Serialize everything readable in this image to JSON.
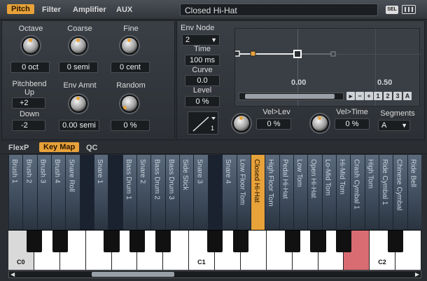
{
  "top_tabs": [
    {
      "label": "Pitch",
      "active": true
    },
    {
      "label": "Filter",
      "active": false
    },
    {
      "label": "Amplifier",
      "active": false
    },
    {
      "label": "AUX",
      "active": false
    }
  ],
  "preset_name": "Closed Hi-Hat",
  "sel_label": "SEL",
  "pitch": {
    "octave_label": "Octave",
    "octave_value": "0 oct",
    "coarse_label": "Coarse",
    "coarse_value": "0 semi",
    "fine_label": "Fine",
    "fine_value": "0 cent",
    "pitchbend_label": "Pitchbend Up",
    "pitchbend_up_value": "+2",
    "down_label": "Down",
    "down_value": "-2",
    "envamnt_label": "Env Amnt",
    "envamnt_value": "0.00 semi",
    "random_label": "Random",
    "random_value": "0 %"
  },
  "envelope": {
    "env_node_label": "Env Node",
    "env_node_value": "2",
    "time_label": "Time",
    "time_value": "100 ms",
    "curve_label": "Curve",
    "curve_value": "0.0",
    "level_label": "Level",
    "level_value": "0 %",
    "graph_label_left": "0.00",
    "graph_label_right": "0.50",
    "zoom_buttons": [
      "1",
      "2",
      "3",
      "A"
    ],
    "vel_lev_label": "Vel>Lev",
    "vel_lev_value": "0 %",
    "vel_time_label": "Vel>Time",
    "vel_time_value": "0 %",
    "segments_label": "Segments",
    "segments_value": "A",
    "curve_shape_number": "1"
  },
  "lower_tabs": [
    {
      "label": "FlexP",
      "active": false
    },
    {
      "label": "Key Map",
      "active": true
    },
    {
      "label": "QC",
      "active": false
    }
  ],
  "keymap": [
    "Brush 1",
    "Brush 2",
    "Brush 3",
    "Brush 4",
    "Snare Roll",
    "",
    "Snare 1",
    "",
    "Bass Drum 1",
    "Snare 2",
    "Bass Drum 2",
    "Bass Drum 3",
    "Side Stick",
    "Snare 3",
    "",
    "Snare 4",
    "Low Floor Tom",
    "Closed Hi-Hat",
    "High Floor Tom",
    "Pedal Hi-Hat",
    "Low Tom",
    "Open Hi-Hat",
    "Lo-Mid Tom",
    "Hi-Mid Tom",
    "Crash Cymbal 1",
    "High Tom",
    "Ride Cymbal 1",
    "Chinese Cymbal",
    "Ride Bell"
  ],
  "selected_key": "Closed Hi-Hat",
  "octave_labels": [
    "C0",
    "C1",
    "C2"
  ],
  "colors": {
    "accent": "#e8a23a",
    "hit_key": "#d96c72"
  }
}
